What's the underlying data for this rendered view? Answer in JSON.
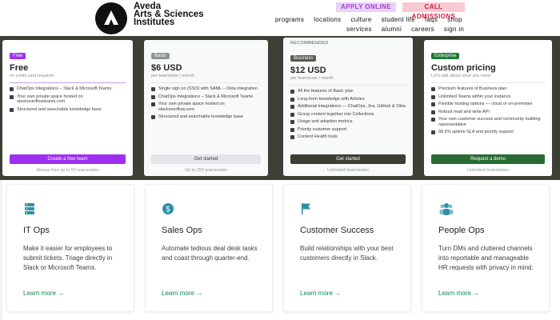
{
  "header": {
    "brand_line1": "Aveda",
    "brand_line2": "Arts & Sciences",
    "brand_line3": "Institutes",
    "apply_label": "APPLY ONLINE",
    "call_label": "CALL ADMISSIONS",
    "nav_primary": [
      "programs",
      "locations",
      "culture",
      "student life",
      "faqs",
      "shop"
    ],
    "nav_secondary": [
      "services",
      "alumni",
      "careers",
      "sign in"
    ]
  },
  "pricing": {
    "plans": [
      {
        "tag": "Free",
        "tag_color": "#9e2ff0",
        "name": "Free",
        "sub": "no credit card required",
        "features": [
          "ChatOps Integrations – Slack & Microsoft Teams",
          "Your own private space hosted on stackoverflowteams.com",
          "Structured and searchable knowledge base"
        ],
        "cta": "Create a free team",
        "cta_bg": "#9e2ff0",
        "cta_fg": "#ffffff",
        "foot": "Always free up to 50 teammates"
      },
      {
        "tag": "Basic",
        "tag_color": "#6a737c",
        "name": "$6 USD",
        "sub": "per teammate / month",
        "features": [
          "Single sign on (SSO) with SAML – Okta integration",
          "ChatOps Integrations – Slack & Microsoft Teams",
          "Your own private space hosted on stackoverflow.com",
          "Structured and searchable knowledge base"
        ],
        "cta": "Get started",
        "cta_bg": "#e3e6e8",
        "cta_fg": "#3b4045",
        "foot": "Up to 250 teammates"
      },
      {
        "recommended": "RECOMMENDED",
        "tag": "Business",
        "tag_color": "#3d3f37",
        "name": "$12 USD",
        "sub": "per teammate / month",
        "features": [
          "All the features of Basic plan",
          "Long-form knowledge with Articles",
          "Additional integrations — ChatOps, Jira, GitHub & Okta",
          "Group content together into Collections",
          "Usage and adoption metrics",
          "Priority customer support",
          "Content Health tools"
        ],
        "cta": "Get started",
        "cta_bg": "#3d3f37",
        "cta_fg": "#ffffff",
        "foot": "Unlimited teammates"
      },
      {
        "tag": "Enterprise",
        "tag_color": "#1e7a36",
        "name": "Custom pricing",
        "sub": "Let's talk about what you need",
        "features": [
          "Premium features of Business plan",
          "Unlimited Teams within your instance",
          "Flexible hosting options — cloud or on-premises",
          "Robust read and write API",
          "Your own customer success and community building representative",
          "99.5% uptime SLA and priority support"
        ],
        "cta": "Request a demo",
        "cta_bg": "#2a6b33",
        "cta_fg": "#ffffff",
        "foot": "Unlimited teammates"
      }
    ]
  },
  "categories": [
    {
      "icon": "server-rack-icon",
      "title": "IT Ops",
      "desc": "Make it easier for employees to submit tickets. Triage directly in Slack or Microsoft Teams.",
      "link": "Learn more →"
    },
    {
      "icon": "dollar-coin-icon",
      "title": "Sales Ops",
      "desc": "Automate tedious deal desk tasks and coast through quarter-end.",
      "link": "Learn more →"
    },
    {
      "icon": "flag-icon",
      "title": "Customer Success",
      "desc": "Build relationships with your best customers directly in Slack.",
      "link": "Learn more →"
    },
    {
      "icon": "people-group-icon",
      "title": "People Ops",
      "desc": "Turn DMs and cluttered channels into reportable and manageable HR requests with privacy in mind.",
      "link": "Learn more →"
    }
  ],
  "colors": {
    "band": "#3d3f37",
    "link_green": "#0a8a4a",
    "icon_teal": "#2d8fa8"
  }
}
